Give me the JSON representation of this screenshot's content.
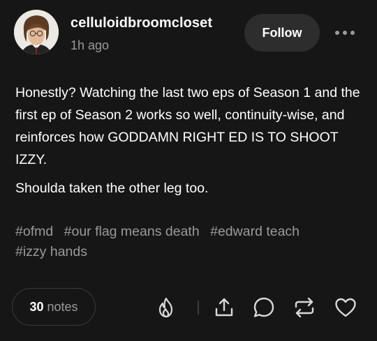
{
  "post": {
    "author": "celluloidbroomcloset",
    "timestamp": "1h ago",
    "follow_label": "Follow",
    "body": [
      "Honestly? Watching the last two eps of Season 1 and the first ep of Season 2 works so well, continuity-wise, and reinforces how GODDAMN RIGHT ED IS TO SHOOT IZZY.",
      "Shoulda taken the other leg too."
    ],
    "tags": [
      "#ofmd",
      "#our flag means death",
      "#edward teach",
      "#izzy hands"
    ]
  },
  "footer": {
    "notes_count": "30",
    "notes_label": "notes",
    "actions": [
      "blaze-icon",
      "share-icon",
      "reply-icon",
      "reblog-icon",
      "like-icon"
    ]
  },
  "colors": {
    "background": "#161616",
    "text": "#ffffff",
    "muted": "#9a9a9a",
    "button": "#2d2d2d"
  }
}
